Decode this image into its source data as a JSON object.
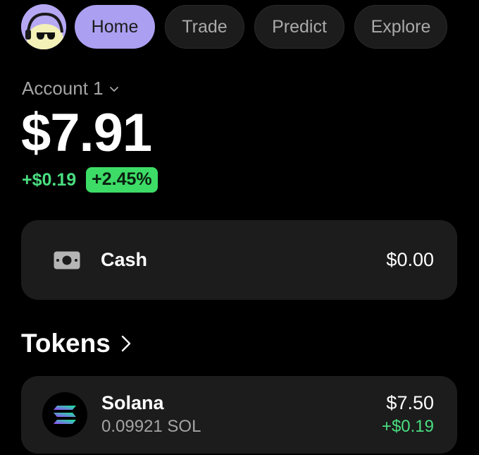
{
  "nav": {
    "tabs": [
      {
        "label": "Home",
        "active": true
      },
      {
        "label": "Trade",
        "active": false
      },
      {
        "label": "Predict",
        "active": false
      },
      {
        "label": "Explore",
        "active": false
      }
    ]
  },
  "account": {
    "name": "Account 1",
    "balance": "$7.91",
    "change_abs": "+$0.19",
    "change_pct": "+2.45%"
  },
  "cash": {
    "label": "Cash",
    "value": "$0.00"
  },
  "tokens": {
    "heading": "Tokens",
    "items": [
      {
        "name": "Solana",
        "amount": "0.09921 SOL",
        "usd_value": "$7.50",
        "change": "+$0.19"
      }
    ]
  },
  "colors": {
    "accent_purple": "#ab9ff2",
    "positive_green": "#4ade80",
    "card_background": "#1c1c1c",
    "page_background": "#000000"
  },
  "icons": {
    "avatar": "avatar-icon",
    "account_dropdown": "chevron-down-icon",
    "cash": "cash-icon",
    "tokens_link": "chevron-right-icon",
    "solana": "solana-logo-icon"
  }
}
